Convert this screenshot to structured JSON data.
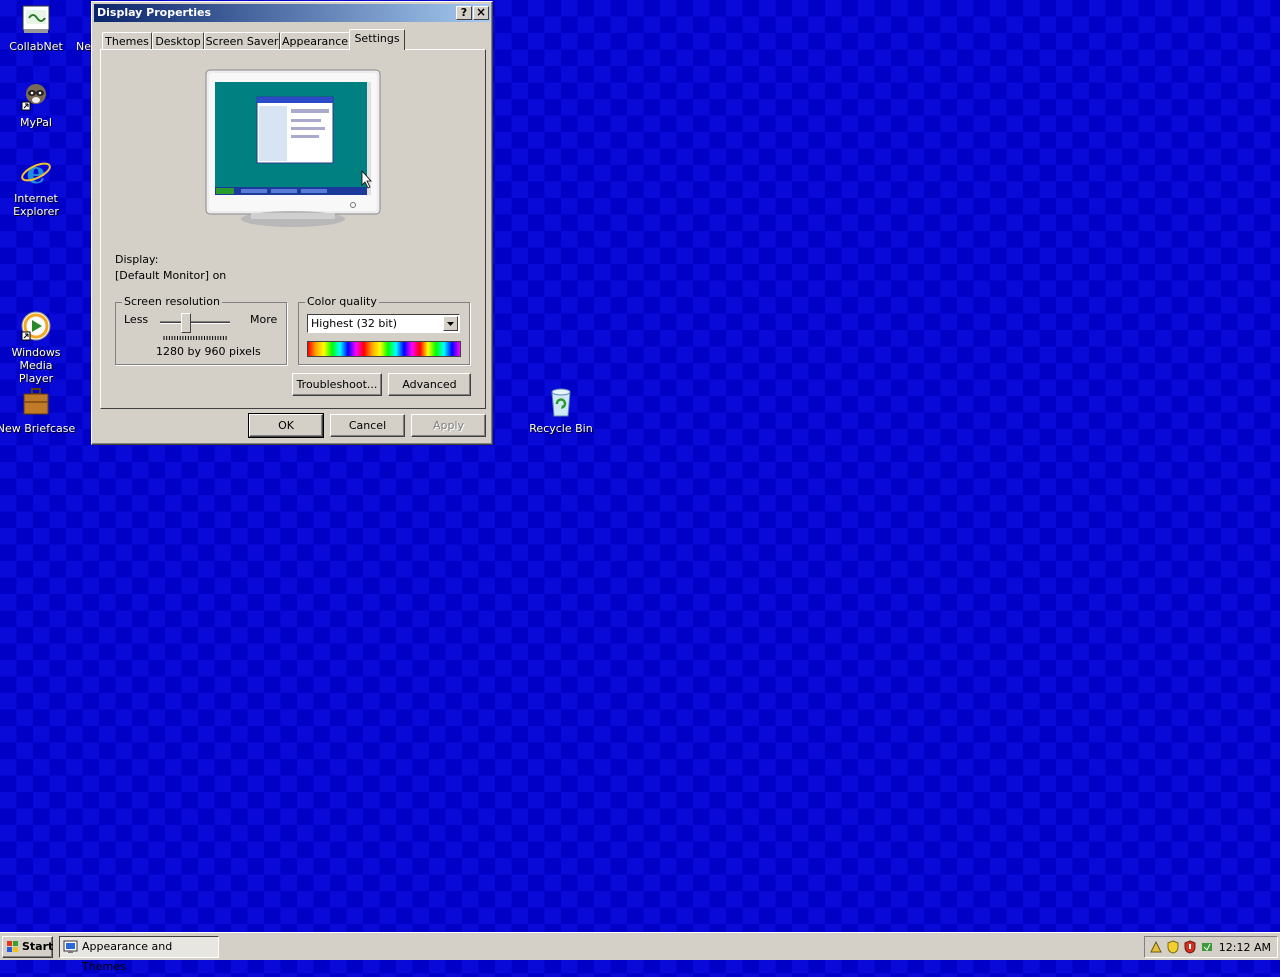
{
  "desktop": {
    "icons": [
      {
        "label": "CollabNet"
      },
      {
        "label": "Ne"
      },
      {
        "label": "MyPal"
      },
      {
        "label": "Internet Explorer"
      },
      {
        "label": "Windows Media Player"
      },
      {
        "label": "New Briefcase"
      },
      {
        "label": "Recycle Bin"
      }
    ]
  },
  "window": {
    "title": "Display Properties",
    "help_btn": "?",
    "close_btn": "×",
    "tabs": [
      "Themes",
      "Desktop",
      "Screen Saver",
      "Appearance",
      "Settings"
    ],
    "active_tab": "Settings",
    "display_label": "Display:",
    "display_value": "[Default Monitor] on",
    "resolution": {
      "group_label": "Screen resolution",
      "less": "Less",
      "more": "More",
      "value_text": "1280 by 960 pixels",
      "slider_level": 0.35
    },
    "color_quality": {
      "group_label": "Color quality",
      "selected": "Highest (32 bit)"
    },
    "troubleshoot_btn": "Troubleshoot...",
    "advanced_btn": "Advanced",
    "ok_btn": "OK",
    "cancel_btn": "Cancel",
    "apply_btn": "Apply"
  },
  "taskbar": {
    "start_label": "Start",
    "task_item": "Appearance and Themes",
    "clock": "12:12 AM"
  },
  "colors": {
    "desktop_bg": "#0a0ad8",
    "titlebar": "#0a246a",
    "face": "#d4d0c8",
    "monitor_screen": "#008080"
  }
}
